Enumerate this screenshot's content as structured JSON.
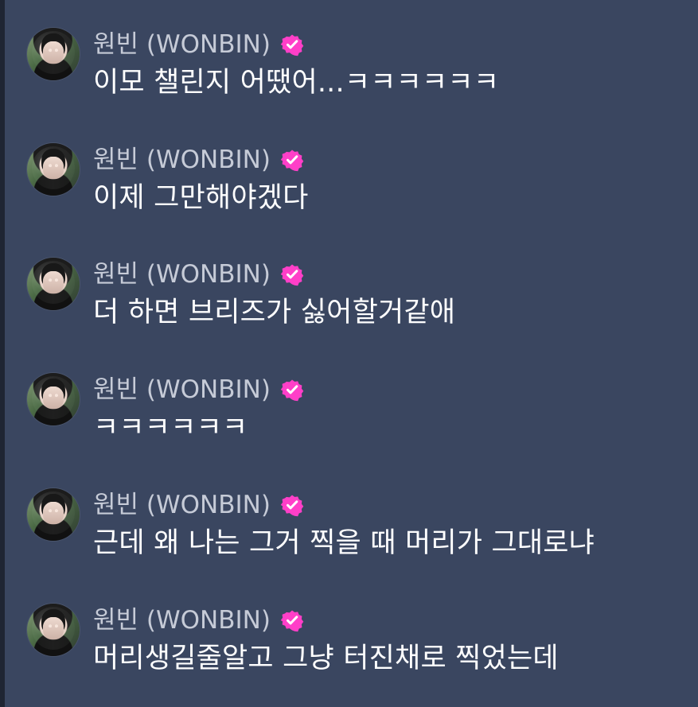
{
  "chat": {
    "messages": [
      {
        "sender": "원빈 (WONBIN)",
        "text": "이모 챌린지 어땠어...ㅋㅋㅋㅋㅋㅋ"
      },
      {
        "sender": "원빈 (WONBIN)",
        "text": "이제 그만해야겠다"
      },
      {
        "sender": "원빈 (WONBIN)",
        "text": "더 하면 브리즈가 싫어할거같애"
      },
      {
        "sender": "원빈 (WONBIN)",
        "text": "ㅋㅋㅋㅋㅋㅋ"
      },
      {
        "sender": "원빈 (WONBIN)",
        "text": "근데 왜 나는 그거 찍을 때 머리가 그대로냐"
      },
      {
        "sender": "원빈 (WONBIN)",
        "text": "머리생길줄알고 그냥 터진채로 찍었는데"
      }
    ]
  },
  "colors": {
    "background": "#3a4660",
    "sender": "#c6cbd7",
    "message": "#ffffff",
    "verified": "#ff3fc8"
  },
  "icons": {
    "avatar": "profile-photo",
    "verified": "verified-icon"
  }
}
